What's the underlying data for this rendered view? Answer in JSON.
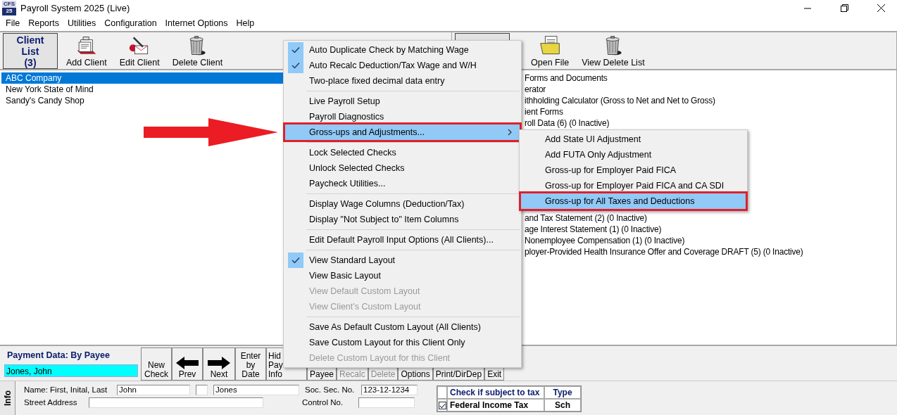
{
  "window": {
    "title": "Payroll System 2025 (Live)",
    "app_icon": [
      "CFS",
      "25"
    ]
  },
  "menu_bar": [
    "File",
    "Reports",
    "Utilities",
    "Configuration",
    "Internet Options",
    "Help"
  ],
  "client_toolbar": {
    "list_button": [
      "Client",
      "List",
      "(3)"
    ],
    "buttons": [
      {
        "kind": "add",
        "label": "Add Client"
      },
      {
        "kind": "edit",
        "label": "Edit Client"
      },
      {
        "kind": "delete",
        "label": "Delete Client"
      }
    ]
  },
  "clients": [
    {
      "name": "ABC Company",
      "selected": true
    },
    {
      "name": "New York State of Mind",
      "selected": false
    },
    {
      "name": "Sandy's Candy Shop",
      "selected": false
    }
  ],
  "file_toolbar": {
    "buttons": [
      {
        "kind": "open",
        "label": "Open File"
      },
      {
        "kind": "delete",
        "label": "View Delete List"
      }
    ]
  },
  "file_list": {
    "rows_above_menu": [
      "Forms and Documents",
      "erator",
      "ithholding Calculator (Gross to Net and Net to Gross)",
      "ient Forms",
      "roll Data  (6) (0 Inactive)"
    ],
    "rows_below_menu": [
      "and Tax Statement  (2) (0 Inactive)",
      "age Interest Statement  (1) (0 Inactive)",
      "Nonemployee Compensation  (1) (0 Inactive)",
      "ployer-Provided Health Insurance Offer and Coverage DRAFT  (5) (0 Inactive)"
    ]
  },
  "options_menu": {
    "groups": [
      [
        {
          "label": "Auto Duplicate Check by Matching Wage",
          "checked": true,
          "disabled": false,
          "selected": false,
          "annotated": false,
          "has_submenu": false
        },
        {
          "label": "Auto Recalc Deduction/Tax Wage and W/H",
          "checked": true,
          "disabled": false,
          "selected": false,
          "annotated": false,
          "has_submenu": false
        },
        {
          "label": "Two-place fixed decimal data entry",
          "checked": false,
          "disabled": false,
          "selected": false,
          "annotated": false,
          "has_submenu": false
        }
      ],
      [
        {
          "label": "Live Payroll Setup",
          "checked": false,
          "disabled": false,
          "selected": false,
          "annotated": false,
          "has_submenu": false
        },
        {
          "label": "Payroll Diagnostics",
          "checked": false,
          "disabled": false,
          "selected": false,
          "annotated": false,
          "has_submenu": false
        },
        {
          "label": "Gross-ups and Adjustments...",
          "checked": false,
          "disabled": false,
          "selected": true,
          "annotated": true,
          "has_submenu": true
        }
      ],
      [
        {
          "label": "Lock Selected Checks",
          "checked": false,
          "disabled": false,
          "selected": false,
          "annotated": false,
          "has_submenu": false
        },
        {
          "label": "Unlock Selected Checks",
          "checked": false,
          "disabled": false,
          "selected": false,
          "annotated": false,
          "has_submenu": false
        },
        {
          "label": "Paycheck Utilities...",
          "checked": false,
          "disabled": false,
          "selected": false,
          "annotated": false,
          "has_submenu": false
        }
      ],
      [
        {
          "label": "Display Wage Columns (Deduction/Tax)",
          "checked": false,
          "disabled": false,
          "selected": false,
          "annotated": false,
          "has_submenu": false
        },
        {
          "label": "Display \"Not Subject to\" Item Columns",
          "checked": false,
          "disabled": false,
          "selected": false,
          "annotated": false,
          "has_submenu": false
        }
      ],
      [
        {
          "label": "Edit Default Payroll Input Options (All Clients)...",
          "checked": false,
          "disabled": false,
          "selected": false,
          "annotated": false,
          "has_submenu": false
        }
      ],
      [
        {
          "label": "View Standard Layout",
          "checked": true,
          "disabled": false,
          "selected": false,
          "annotated": false,
          "has_submenu": false
        },
        {
          "label": "View Basic Layout",
          "checked": false,
          "disabled": false,
          "selected": false,
          "annotated": false,
          "has_submenu": false
        },
        {
          "label": "View Default Custom Layout",
          "checked": false,
          "disabled": true,
          "selected": false,
          "annotated": false,
          "has_submenu": false
        },
        {
          "label": "View Client's Custom Layout",
          "checked": false,
          "disabled": true,
          "selected": false,
          "annotated": false,
          "has_submenu": false
        }
      ],
      [
        {
          "label": "Save As Default Custom Layout (All Clients)",
          "checked": false,
          "disabled": false,
          "selected": false,
          "annotated": false,
          "has_submenu": false
        },
        {
          "label": "Save Custom Layout for this Client Only",
          "checked": false,
          "disabled": false,
          "selected": false,
          "annotated": false,
          "has_submenu": false
        },
        {
          "label": "Delete Custom Layout for this Client",
          "checked": false,
          "disabled": true,
          "selected": false,
          "annotated": false,
          "has_submenu": false
        }
      ]
    ]
  },
  "submenu": {
    "items": [
      {
        "label": "Add State UI Adjustment",
        "selected": false,
        "annotated": false
      },
      {
        "label": "Add FUTA Only Adjustment",
        "selected": false,
        "annotated": false
      },
      {
        "label": "Gross-up for Employer Paid FICA",
        "selected": false,
        "annotated": false
      },
      {
        "label": "Gross-up for Employer Paid FICA and CA SDI",
        "selected": false,
        "annotated": false
      },
      {
        "label": "Gross-up for All Taxes and Deductions",
        "selected": true,
        "annotated": true
      }
    ]
  },
  "payment": {
    "title": "Payment Data: By Payee",
    "payee": "Jones, John",
    "nav_buttons": [
      {
        "kind": "text",
        "lines": [
          "New",
          "Check"
        ]
      },
      {
        "kind": "prev",
        "lines": [
          "Prev"
        ]
      },
      {
        "kind": "next",
        "lines": [
          "Next"
        ]
      },
      {
        "kind": "text",
        "lines": [
          "Enter",
          "by",
          "Date"
        ]
      },
      {
        "kind": "partial",
        "lines": [
          "Hid",
          "Pay",
          "Info"
        ]
      }
    ],
    "action_buttons": [
      {
        "label": "Payee",
        "disabled": false
      },
      {
        "label": "Recalc",
        "disabled": true
      },
      {
        "label": "Delete",
        "disabled": true
      },
      {
        "label": "Options",
        "disabled": false
      },
      {
        "label": "Print/DirDep",
        "disabled": false
      },
      {
        "label": "Exit",
        "disabled": false
      }
    ]
  },
  "info": {
    "tab": "Info",
    "name_label": "Name: First, Inital, Last",
    "first": "John",
    "last": "Jones",
    "street_label": "Street Address",
    "ssn_label": "Soc. Sec. No.",
    "ssn": "123-12-1234",
    "control_label": "Control No."
  },
  "tax_table": {
    "columns": [
      "Check if subject to tax",
      "Type"
    ],
    "rows": [
      {
        "name": "Federal Income Tax",
        "type": "Sch",
        "checked": true
      }
    ]
  }
}
